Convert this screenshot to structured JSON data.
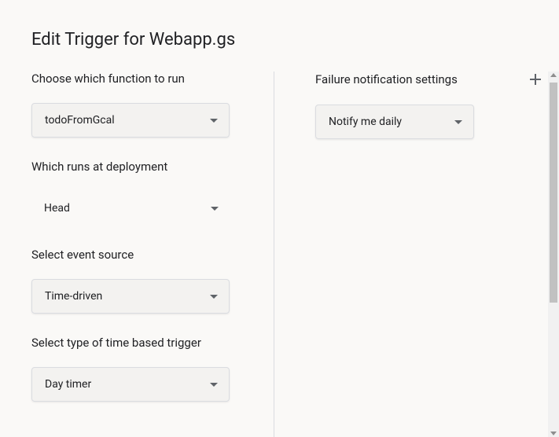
{
  "dialog": {
    "title": "Edit Trigger for Webapp.gs"
  },
  "left": {
    "function": {
      "label": "Choose which function to run",
      "value": "todoFromGcal"
    },
    "deployment": {
      "label": "Which runs at deployment",
      "value": "Head"
    },
    "eventSource": {
      "label": "Select event source",
      "value": "Time-driven"
    },
    "triggerType": {
      "label": "Select type of time based trigger",
      "value": "Day timer"
    }
  },
  "right": {
    "notification": {
      "label": "Failure notification settings",
      "value": "Notify me daily"
    }
  }
}
